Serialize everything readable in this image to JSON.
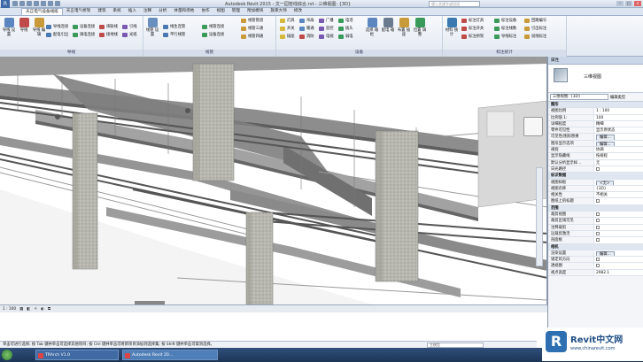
{
  "titlebar": {
    "title": "Autodesk Revit 2015 -    文一园管线综合.rvt - 三维视图: {3D}",
    "search_placeholder": "键入关键字或短语"
  },
  "tabs": [
    "天正电气设备线缆",
    "天正电气桥架",
    "建筑",
    "系统",
    "插入",
    "注释",
    "分析",
    "体量和场地",
    "协作",
    "视图",
    "管理",
    "附加模块",
    "族库大师",
    "修改"
  ],
  "ribbon": {
    "groups": [
      {
        "label": "导线",
        "big": [
          "导线\n设置",
          "导线",
          "导线\n编辑"
        ],
        "small": [
          "导线连接",
          "配电引出",
          "设备连接",
          "调电连接",
          "串联线",
          "接地线",
          "引线",
          "光纸"
        ]
      },
      {
        "label": "线管",
        "big": [
          "线管\n设置"
        ],
        "small": [
          "线生连管",
          "平行线管",
          "线管连接",
          "设备连接",
          "线管管道",
          "线管三通",
          "线管四通"
        ]
      },
      {
        "label": "设备",
        "big": [
          "选择\n箱柜",
          "配电\n箱",
          "布置\n插座",
          "位置\n调整"
        ],
        "small": [
          "灯具",
          "开关",
          "插座",
          "吊扇",
          "暖通",
          "消防",
          "广播",
          "监控",
          "电视",
          "电话",
          "插头",
          "弱电"
        ]
      },
      {
        "label": "标注统计",
        "big": [
          "材料\n统计"
        ],
        "small": [
          "标注灯具",
          "标注开关",
          "标注桥架",
          "标注设备",
          "标注线数",
          "导线标注",
          "回路编号",
          "引出标注",
          "说线标注"
        ]
      }
    ]
  },
  "statusbar": {
    "scale": "1 : 100"
  },
  "message": "单击可进行选择; 按 Tab 键并单击可选择其他项目; 按 Ctrl 键并单击可将新项目添加到选择集; 按 Shift 键并单击可取消选择。",
  "model_placeholder": "主模型",
  "taskbar": [
    "TRArch V1.0",
    "Autodesk Revit 20..."
  ],
  "properties": {
    "header": "属性",
    "type_name": "三维视图",
    "selector": "三维视图: {3D}",
    "edit_type": "编辑类型",
    "rows": [
      {
        "cat": "图形"
      },
      {
        "k": "视图比例",
        "v": "1 : 100"
      },
      {
        "k": "比例值 1:",
        "v": "100"
      },
      {
        "k": "详细程度",
        "v": "精细"
      },
      {
        "k": "零件可见性",
        "v": "显示原状态"
      },
      {
        "k": "可见性/图形替换",
        "v": "编辑..."
      },
      {
        "k": "图形显示选项",
        "v": "编辑..."
      },
      {
        "k": "规程",
        "v": "协调"
      },
      {
        "k": "显示隐藏线",
        "v": "按规程"
      },
      {
        "k": "默认分析显示样...",
        "v": "无"
      },
      {
        "k": "日光路径",
        "v": ""
      },
      {
        "cat": "标识数据"
      },
      {
        "k": "视图样板",
        "v": "<无>"
      },
      {
        "k": "视图名称",
        "v": "{3D}"
      },
      {
        "k": "相关性",
        "v": "不相关"
      },
      {
        "k": "图纸上的标题",
        "v": ""
      },
      {
        "cat": "范围"
      },
      {
        "k": "裁剪视图",
        "v": ""
      },
      {
        "k": "裁剪区域可见",
        "v": ""
      },
      {
        "k": "注释裁剪",
        "v": ""
      },
      {
        "k": "远裁剪激活",
        "v": ""
      },
      {
        "k": "剖面框",
        "v": ""
      },
      {
        "cat": "相机"
      },
      {
        "k": "渲染设置",
        "v": "编辑..."
      },
      {
        "k": "锁定的方向",
        "v": ""
      },
      {
        "k": "透视图",
        "v": ""
      },
      {
        "k": "视点高度",
        "v": "2982.1"
      }
    ]
  },
  "logo": {
    "brand": "Revit中文网",
    "url": "www.chinarevit.com"
  }
}
